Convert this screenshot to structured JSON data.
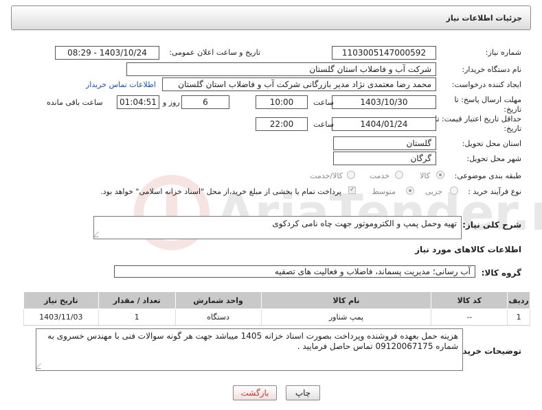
{
  "header": {
    "title": "جزئیات اطلاعات نیاز"
  },
  "form": {
    "need_number_label": "شماره نیاز:",
    "need_number": "1103005147000592",
    "announce_label": "تاریخ و ساعت اعلان عمومی:",
    "announce_value": "1403/10/24 - 08:29",
    "buyer_label": "نام دستگاه خریدار:",
    "buyer_value": "شرکت آب و فاضلاب استان گلستان",
    "creator_label": "ایجاد کننده درخواست:",
    "creator_value": "محمد رضا معتمدی نژاد مدیر بازرگانی شرکت آب و فاضلاب استان گلستان",
    "contact_link": "اطلاعات تماس خریدار",
    "deadline_label_1": "مهلت ارسال پاسخ: تا",
    "deadline_label_2": "تاریخ:",
    "deadline_date": "1403/10/30",
    "hour_label": "ساعت",
    "deadline_time": "10:00",
    "days_value": "6",
    "days_label": "روز و",
    "remaining_time": "01:04:51",
    "remaining_label": "ساعت باقی مانده",
    "validity_label_1": "حداقل تاریخ اعتبار قیمت: تا",
    "validity_label_2": "تاریخ:",
    "validity_date": "1404/01/24",
    "validity_hour_label": "ساعت",
    "validity_time": "22:00",
    "province_label": "استان محل تحویل:",
    "province_value": "گلستان",
    "city_label": "شهر محل تحویل:",
    "city_value": "گرگان",
    "category_label": "طبقه بندی موضوعی:",
    "category_options": [
      "کالا",
      "خدمت",
      "کالا/خدمت"
    ],
    "process_label": "نوع فرآیند خرید :",
    "process_options": [
      "جزیی",
      "متوسط"
    ],
    "payment_note": "پرداخت تمام یا بخشی از مبلغ خرید،از محل \"اسناد خزانه اسلامی\" خواهد بود.",
    "summary_label": "شرح کلی نیاز:",
    "summary_value": "تهیه وحمل پمپ و الکتروموتور جهت چاه نامی کردکوی"
  },
  "goods": {
    "section_title": "اطلاعات کالاهای مورد نیاز",
    "group_label": "گروه کالا:",
    "group_value": "آب رسانی؛ مدیریت پسماند، فاضلاب و فعالیت های تصفیه",
    "columns": [
      "ردیف",
      "کد کالا",
      "نام کالا",
      "واحد شمارش",
      "تعداد / مقدار",
      "تاریخ نیاز"
    ],
    "rows": [
      [
        "1",
        "--",
        "پمپ شناور",
        "دستگاه",
        "1",
        "1403/11/03"
      ]
    ]
  },
  "buyer_notes": {
    "label": "توضیحات خریدار:",
    "text": "هزینه حمل بعهده فروشنده وپرداخت بصورت اسناد خزانه 1405 میباشد جهت هر گونه سوالات فنی با مهندس خسروی به شماره 09120067175 تماس حاصل فرمایید ."
  },
  "buttons": {
    "print": "چاپ",
    "back": "بازگشت"
  },
  "watermark": {
    "text": "AriaTender.net"
  },
  "colors": {
    "back_button_text": "#c0392b",
    "link": "#1d4fa3",
    "table_header": "#c9c9c9"
  }
}
